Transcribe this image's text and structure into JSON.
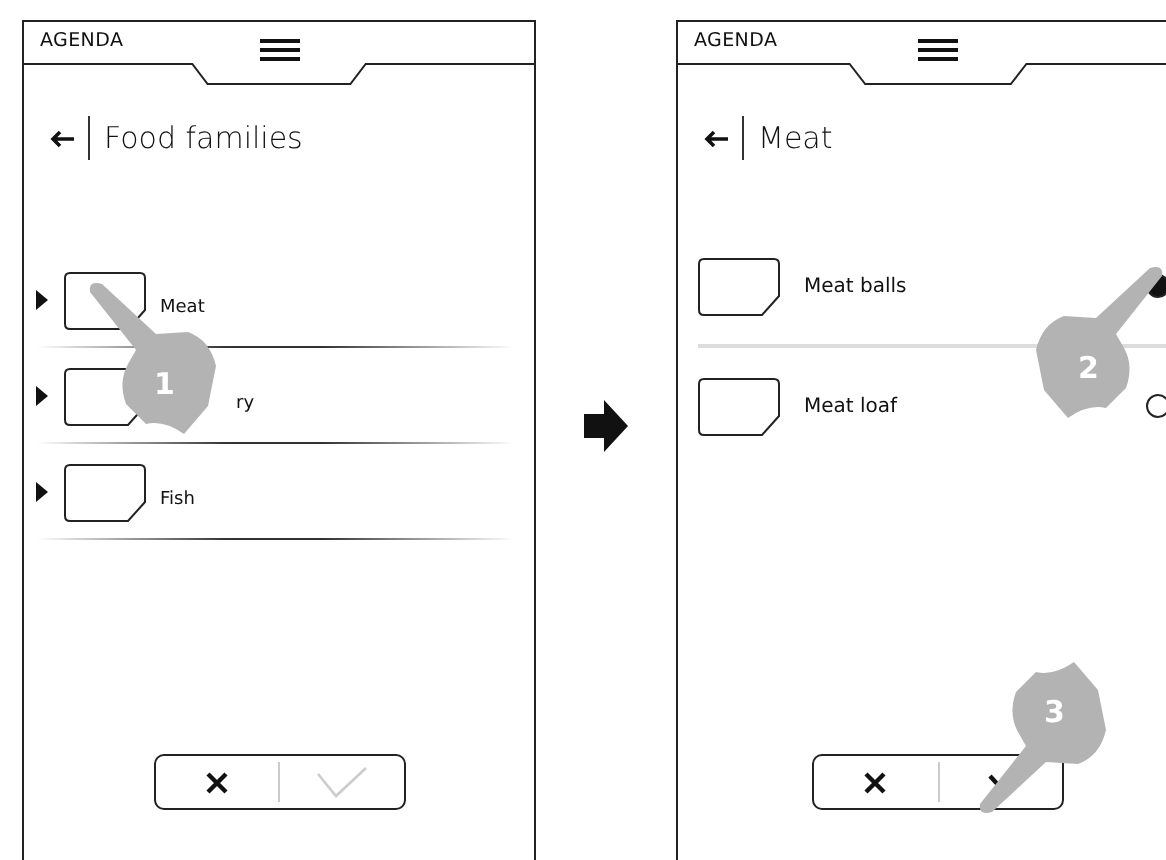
{
  "screens": [
    {
      "header": {
        "title": "AGENDA"
      },
      "page_title": "Food families",
      "items": [
        {
          "kind": "category",
          "label": "Meat"
        },
        {
          "kind": "category",
          "label": "ry",
          "partly_covered": true
        },
        {
          "kind": "category",
          "label": "Fish"
        }
      ],
      "footer": {
        "confirm_disabled": true
      },
      "hands": [
        {
          "step": "1"
        }
      ]
    },
    {
      "header": {
        "title": "AGENDA"
      },
      "page_title": "Meat",
      "items": [
        {
          "kind": "option",
          "label": "Meat balls",
          "selected": true
        },
        {
          "kind": "option",
          "label": "Meat loaf",
          "selected": false
        }
      ],
      "footer": {
        "confirm_disabled": false
      },
      "hands": [
        {
          "step": "2"
        },
        {
          "step": "3"
        }
      ]
    }
  ]
}
